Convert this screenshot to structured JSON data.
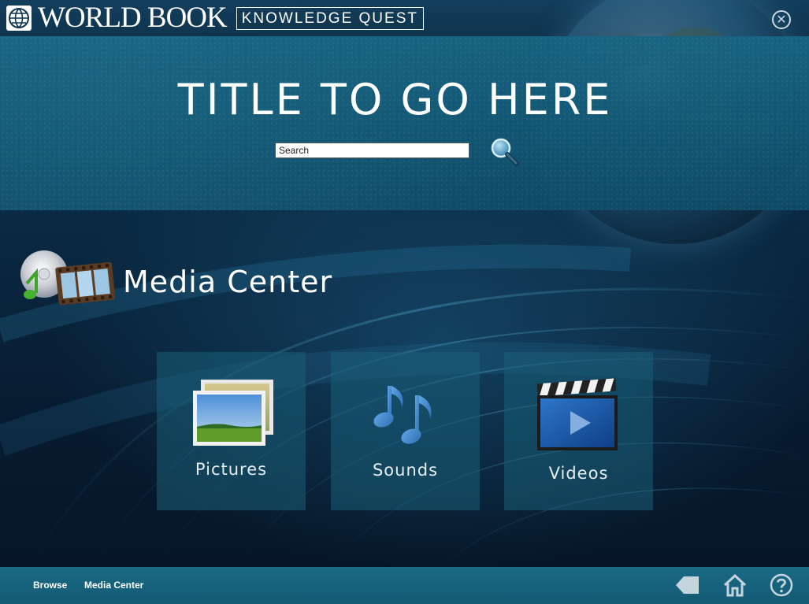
{
  "app": {
    "brand": "WORLD BOOK",
    "product": "KNOWLEDGE QUEST",
    "close_icon": "close-circle-icon"
  },
  "header": {
    "title": "TITLE TO GO HERE",
    "search": {
      "placeholder": "Search",
      "value": ""
    },
    "search_icon": "magnifier-icon"
  },
  "main": {
    "section_title": "Media Center",
    "section_icon": "media-center-icon",
    "tiles": [
      {
        "label": "Pictures",
        "icon": "pictures-icon"
      },
      {
        "label": "Sounds",
        "icon": "music-notes-icon"
      },
      {
        "label": "Videos",
        "icon": "clapperboard-icon"
      }
    ]
  },
  "footer": {
    "breadcrumbs": [
      "Browse",
      "Media Center"
    ],
    "icons": [
      "back-icon",
      "home-icon",
      "help-icon"
    ]
  },
  "colors": {
    "header_band": "#135a77",
    "tile_bg": "#1a5f78",
    "footer": "#165f7a",
    "text": "#ffffff"
  }
}
